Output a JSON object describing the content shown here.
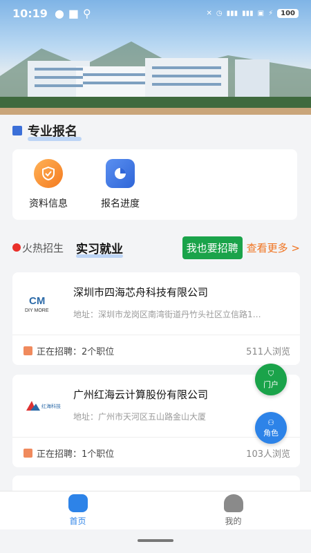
{
  "status_bar": {
    "time": "10:19",
    "battery": "100"
  },
  "section": {
    "title": "专业报名"
  },
  "quick_actions": [
    {
      "label": "资料信息",
      "icon": "shield-check-icon"
    },
    {
      "label": "报名进度",
      "icon": "pie-chart-icon"
    }
  ],
  "tabs": {
    "hot": "火热招生",
    "intern": "实习就业",
    "recruit_button": "我也要招聘",
    "more": "查看更多 >"
  },
  "companies": [
    {
      "name": "深圳市四海芯舟科技有限公司",
      "address": "地址：深圳市龙岗区南湾街道丹竹头社区立信路1…",
      "recruiting": "正在招聘：2个职位",
      "views": "511人浏览",
      "logo_text": "DIY MORE"
    },
    {
      "name": "广州红海云计算股份有限公司",
      "address": "地址：广州市天河区五山路金山大厦",
      "recruiting": "正在招聘：1个职位",
      "views": "103人浏览",
      "logo_text": "红海科技"
    }
  ],
  "fabs": {
    "portal": "门户",
    "role": "角色"
  },
  "bottom_nav": [
    {
      "label": "首页",
      "icon": "home-icon"
    },
    {
      "label": "我的",
      "icon": "user-icon"
    }
  ],
  "colors": {
    "accent": "#2d83e8",
    "green": "#1aa34a",
    "orange": "#f07320"
  }
}
